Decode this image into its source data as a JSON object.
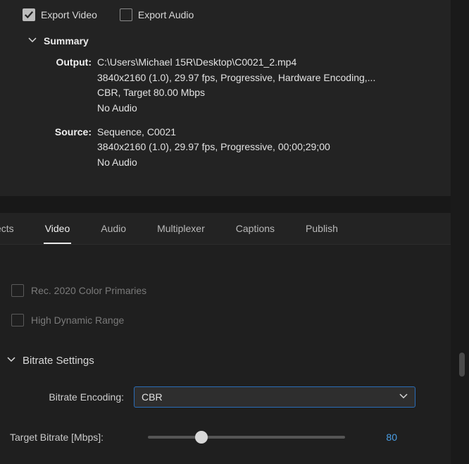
{
  "checks": {
    "export_video": {
      "label": "Export Video",
      "checked": true
    },
    "export_audio": {
      "label": "Export Audio",
      "checked": false
    }
  },
  "summary": {
    "header": "Summary",
    "output": {
      "label": "Output:",
      "line1": "C:\\Users\\Michael 15R\\Desktop\\C0021_2.mp4",
      "line2": "3840x2160 (1.0), 29.97 fps, Progressive, Hardware Encoding,...",
      "line3": "CBR, Target 80.00 Mbps",
      "line4": "No Audio"
    },
    "source": {
      "label": "Source:",
      "line1": "Sequence, C0021",
      "line2": "3840x2160 (1.0), 29.97 fps, Progressive, 00;00;29;00",
      "line3": "No Audio"
    }
  },
  "tabs": {
    "partial": "ects",
    "video": "Video",
    "audio": "Audio",
    "multiplexer": "Multiplexer",
    "captions": "Captions",
    "publish": "Publish",
    "active": "video"
  },
  "options": {
    "rec2020": {
      "label": "Rec. 2020 Color Primaries",
      "checked": false
    },
    "hdr": {
      "label": "High Dynamic Range",
      "checked": false
    }
  },
  "bitrate": {
    "header": "Bitrate Settings",
    "encoding_label": "Bitrate Encoding:",
    "encoding_value": "CBR",
    "target_label": "Target Bitrate [Mbps]:",
    "target_value": "80",
    "slider_percent": 27
  }
}
